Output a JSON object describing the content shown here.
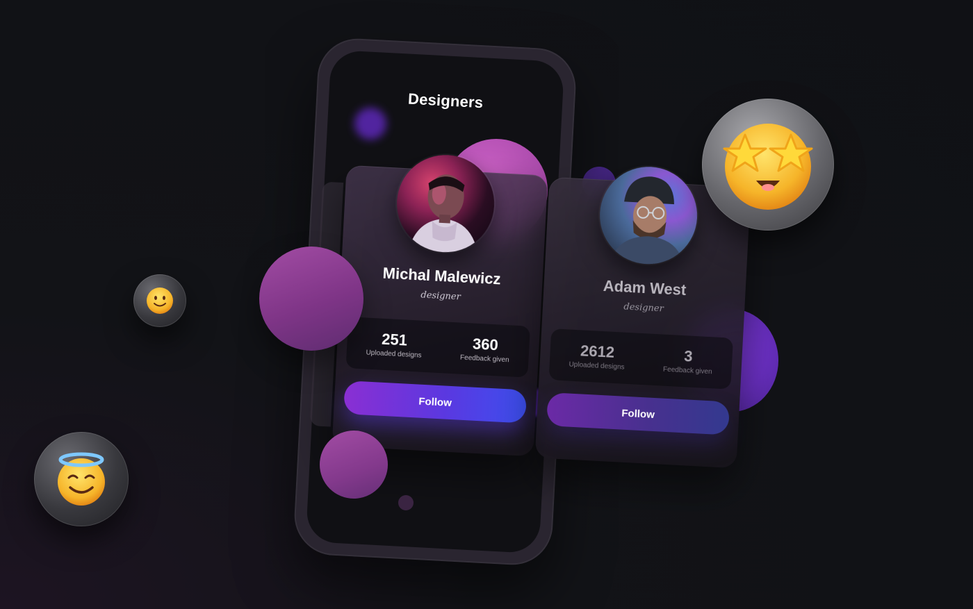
{
  "screen": {
    "title": "Designers"
  },
  "cards": [
    {
      "name": "Michal Malewicz",
      "role": "designer",
      "stats": [
        {
          "value": "251",
          "label": "Uploaded designs"
        },
        {
          "value": "360",
          "label": "Feedback given"
        }
      ],
      "follow_label": "Follow"
    },
    {
      "name": "Adam West",
      "role": "designer",
      "stats": [
        {
          "value": "2612",
          "label": "Uploaded designs"
        },
        {
          "value": "3",
          "label": "Feedback given"
        }
      ],
      "follow_label": "Follow"
    }
  ],
  "emojis": {
    "star": "star-struck-emoji-icon",
    "smile": "slightly-smiling-emoji-icon",
    "angel": "smiling-face-with-halo-emoji-icon"
  },
  "colors": {
    "background": "#101115",
    "accent_purple": "#8a2fd3",
    "accent_blue": "#3c4ff0",
    "blob_pink": "#c35ac0"
  }
}
